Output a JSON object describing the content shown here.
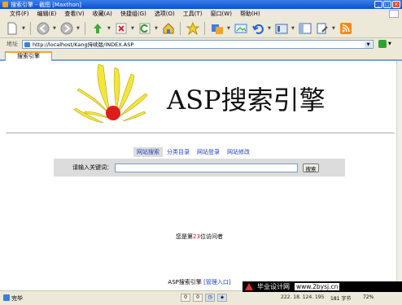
{
  "window": {
    "title": "搜索引擎 - 截图 [Maxthon]",
    "controls": [
      "_",
      "□",
      "×"
    ]
  },
  "menu": [
    "文件(F)",
    "编辑(E)",
    "查看(V)",
    "收藏(A)",
    "快捷组(G)",
    "选项(O)",
    "工具(T)",
    "窗口(W)",
    "帮助(H)"
  ],
  "address": {
    "label": "地址",
    "url": "http://localhost/Kang持续版/INDEX.ASP"
  },
  "tab": {
    "title": "搜索引擎"
  },
  "site": {
    "logo_text": "ASP搜索引擎",
    "nav": [
      "网站搜索",
      "分类目录",
      "网站登录",
      "网站修改"
    ],
    "search_label": "请输入关键词：",
    "search_value": "",
    "search_button": "搜索",
    "visitor_prefix": "您是第",
    "visitor_count": "23",
    "visitor_suffix": "位访问者",
    "footer_text": "ASP搜索引擎",
    "footer_link": "[管理入口]"
  },
  "status": {
    "text": "完毕",
    "cells": [
      "0",
      "0"
    ],
    "ip": "222. 18. 124. 195",
    "bytes": "181 字节",
    "zoom": "72%"
  },
  "watermark": {
    "text": "毕业设计网",
    "site": "www.2bysj.cn"
  },
  "colors": {
    "accent": "#0a4fd6",
    "link": "#1a3fc0",
    "counter": "#d01010",
    "logo_sun": "#e31b1b",
    "logo_rays": "#f3e63a"
  }
}
